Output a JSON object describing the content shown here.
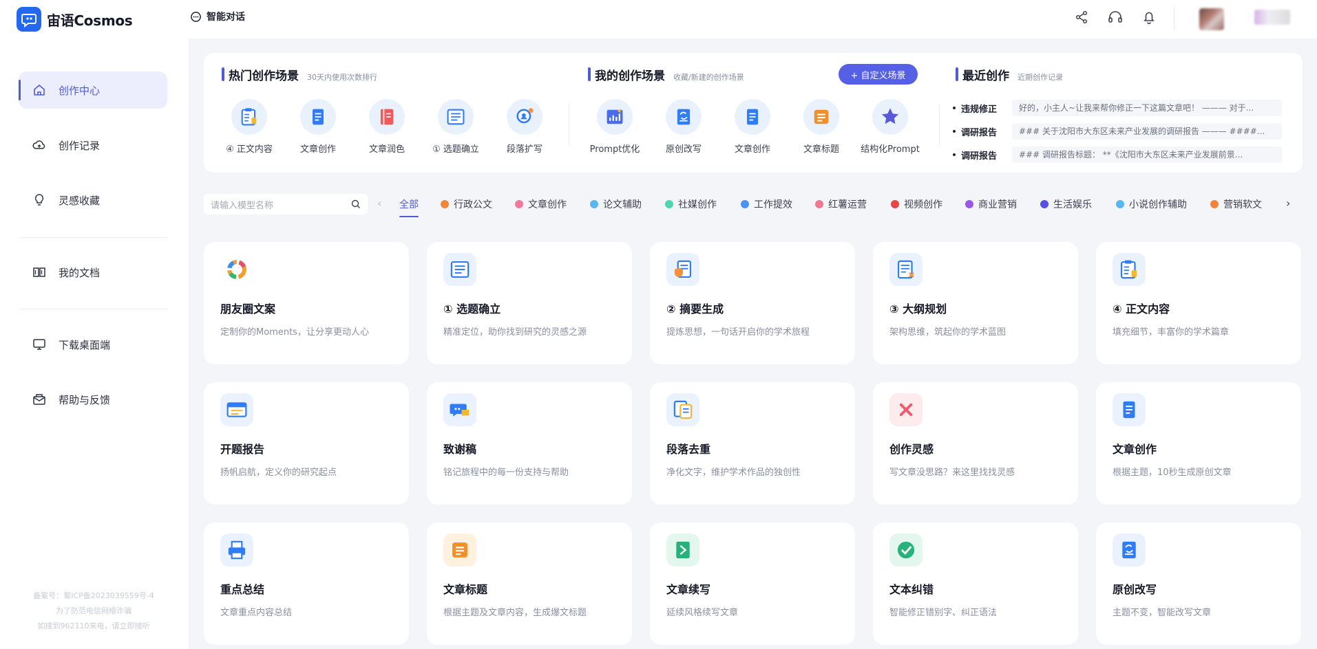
{
  "app": {
    "name": "宙语Cosmos",
    "chat_label": "智能对话"
  },
  "sidebar": {
    "items": [
      {
        "label": "创作中心",
        "icon": "home-icon",
        "active": true
      },
      {
        "label": "创作记录",
        "icon": "cloud-icon"
      },
      {
        "label": "灵感收藏",
        "icon": "bulb-icon"
      },
      {
        "label": "我的文档",
        "icon": "book-icon"
      },
      {
        "label": "下载桌面端",
        "icon": "monitor-icon"
      },
      {
        "label": "帮助与反馈",
        "icon": "mail-icon"
      }
    ],
    "icp": [
      "备案号：蜀ICP备2023039559号-4",
      "为了防范电信网络诈骗",
      "如接到962110来电，请立即接听"
    ]
  },
  "hot": {
    "title": "热门创作场景",
    "subtitle": "30天内使用次数排行",
    "items": [
      {
        "label": "④ 正文内容",
        "icon": "clipboard-icon",
        "color": "#2f7cf6"
      },
      {
        "label": "文章创作",
        "icon": "document-icon",
        "color": "#2f7cf6"
      },
      {
        "label": "文章润色",
        "icon": "book-icon",
        "color": "#ef5b5b"
      },
      {
        "label": "① 选题确立",
        "icon": "list-icon",
        "color": "#2f7cf6"
      },
      {
        "label": "段落扩写",
        "icon": "search-icon",
        "color": "#2f7cf6"
      }
    ]
  },
  "mine": {
    "title": "我的创作场景",
    "subtitle": "收藏/新建的创作场景",
    "button": "+ 自定义场景",
    "items": [
      {
        "label": "Prompt优化",
        "icon": "chart-icon",
        "color": "#4c6be8"
      },
      {
        "label": "原创改写",
        "icon": "rewrite-icon",
        "color": "#2f7cf6"
      },
      {
        "label": "文章创作",
        "icon": "document-icon",
        "color": "#2f7cf6"
      },
      {
        "label": "文章标题",
        "icon": "title-icon",
        "color": "#f0902c"
      },
      {
        "label": "结构化Prompt",
        "icon": "star-icon",
        "color": "#5a5ad8"
      }
    ]
  },
  "recent": {
    "title": "最近创作",
    "subtitle": "近期创作记录",
    "items": [
      {
        "type": "违规修正",
        "snippet": "好的，小主人~让我来帮你修正一下这篇文章吧！ ——— 对于..."
      },
      {
        "type": "调研报告",
        "snippet": "### 关于沈阳市大东区未来产业发展的调研报告 ——— ####..."
      },
      {
        "type": "调研报告",
        "snippet": "### 调研报告标题： **《沈阳市大东区未来产业发展前景..."
      }
    ]
  },
  "search": {
    "placeholder": "请输入模型名称"
  },
  "categories": [
    {
      "label": "全部",
      "color": "",
      "active": true
    },
    {
      "label": "行政公文",
      "color": "#f0863e"
    },
    {
      "label": "文章创作",
      "color": "#f07a9b"
    },
    {
      "label": "论文辅助",
      "color": "#5ab6f0"
    },
    {
      "label": "社媒创作",
      "color": "#4fd6b0"
    },
    {
      "label": "工作提效",
      "color": "#4a93f0"
    },
    {
      "label": "红薯运营",
      "color": "#f07a90"
    },
    {
      "label": "视频创作",
      "color": "#e84646"
    },
    {
      "label": "商业营销",
      "color": "#9b57e8"
    },
    {
      "label": "生活娱乐",
      "color": "#5a4fe0"
    },
    {
      "label": "小说创作辅助",
      "color": "#5ab6f0"
    },
    {
      "label": "营销软文",
      "color": "#f0863e"
    }
  ],
  "cards": [
    {
      "title": "朋友圈文案",
      "desc": "定制你的Moments，让分享更动人心",
      "icon": "ring-icon",
      "bg": "#ffffff",
      "color": "#f0a030"
    },
    {
      "title": "① 选题确立",
      "desc": "精准定位，助你找到研究的灵感之源",
      "icon": "list-icon",
      "bg": "#eaf2ff",
      "color": "#2f7cf6"
    },
    {
      "title": "② 摘要生成",
      "desc": "提炼思想，一句话开启你的学术旅程",
      "icon": "shield-doc-icon",
      "bg": "#eaf2ff",
      "color": "#2f7cf6"
    },
    {
      "title": "③ 大纲规划",
      "desc": "架构思维，筑起你的学术蓝图",
      "icon": "outline-icon",
      "bg": "#eaf2ff",
      "color": "#2f7cf6"
    },
    {
      "title": "④ 正文内容",
      "desc": "填充细节，丰富你的学术篇章",
      "icon": "clipboard-icon",
      "bg": "#eaf2ff",
      "color": "#2f7cf6"
    },
    {
      "title": "开题报告",
      "desc": "扬帆启航，定义你的研究起点",
      "icon": "report-icon",
      "bg": "#eaf2ff",
      "color": "#2f7cf6"
    },
    {
      "title": "致谢稿",
      "desc": "铭记旅程中的每一份支持与帮助",
      "icon": "speech-icon",
      "bg": "#eaf2ff",
      "color": "#2f7cf6"
    },
    {
      "title": "段落去重",
      "desc": "净化文字，维护学术作品的独创性",
      "icon": "dedupe-icon",
      "bg": "#eaf2ff",
      "color": "#2f7cf6"
    },
    {
      "title": "创作灵感",
      "desc": "写文章没思路？来这里找找灵感",
      "icon": "cross-icon",
      "bg": "#fdecee",
      "color": "#ef5b6b"
    },
    {
      "title": "文章创作",
      "desc": "根据主题，10秒生成原创文章",
      "icon": "document-icon",
      "bg": "#eaf2ff",
      "color": "#2f7cf6"
    },
    {
      "title": "重点总结",
      "desc": "文章重点内容总结",
      "icon": "printer-icon",
      "bg": "#eaf2ff",
      "color": "#2f7cf6"
    },
    {
      "title": "文章标题",
      "desc": "根据主题及文章内容，生成爆文标题",
      "icon": "title-icon",
      "bg": "#fff1e0",
      "color": "#f0902c"
    },
    {
      "title": "文章续写",
      "desc": "延续风格续写文章",
      "icon": "continue-icon",
      "bg": "#e4f7ef",
      "color": "#26b27a"
    },
    {
      "title": "文本纠错",
      "desc": "智能修正错别字、纠正语法",
      "icon": "check-icon",
      "bg": "#e4f7ef",
      "color": "#26b27a"
    },
    {
      "title": "原创改写",
      "desc": "主题不变，智能改写文章",
      "icon": "rewrite-icon",
      "bg": "#eaf2ff",
      "color": "#2f7cf6"
    }
  ]
}
